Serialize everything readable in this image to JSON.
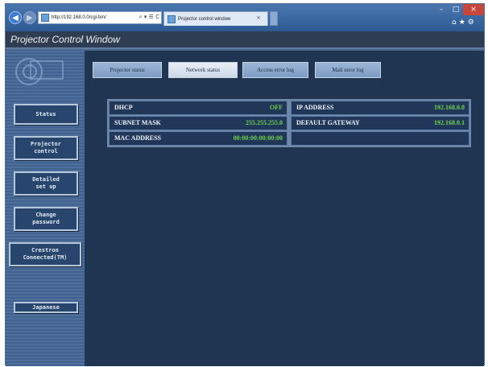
{
  "browser": {
    "url": "http://192.168.0.0/cgi-bin/",
    "url_tools": "⌕ ▾ ☰ C",
    "tab_title": "Projector control window",
    "tab_close": "×"
  },
  "page": {
    "title": "Projector Control Window"
  },
  "sidebar": {
    "items": [
      {
        "label": "Status"
      },
      {
        "label": "Projector\ncontrol"
      },
      {
        "label": "Detailed\nset up"
      },
      {
        "label": "Change\npassword"
      },
      {
        "label": "Crestron\nConnected(TM)"
      },
      {
        "label": "Japanese"
      }
    ]
  },
  "tabs": [
    {
      "label": "Projector status",
      "active": false
    },
    {
      "label": "Network status",
      "active": true
    },
    {
      "label": "Access error log",
      "active": false
    },
    {
      "label": "Mail error log",
      "active": false
    }
  ],
  "network_status": {
    "dhcp": {
      "label": "DHCP",
      "value": "OFF"
    },
    "ip_address": {
      "label": "IP ADDRESS",
      "value": "192.168.0.8"
    },
    "subnet_mask": {
      "label": "SUBNET MASK",
      "value": "255.255.255.0"
    },
    "default_gateway": {
      "label": "DEFAULT GATEWAY",
      "value": "192.168.0.1"
    },
    "mac_address": {
      "label": "MAC ADDRESS",
      "value": "00:00:00:00:00:00"
    }
  },
  "colors": {
    "value_text": "#6fd14a",
    "sidebar_button": "#27456d",
    "content_background": "#1f3552"
  }
}
